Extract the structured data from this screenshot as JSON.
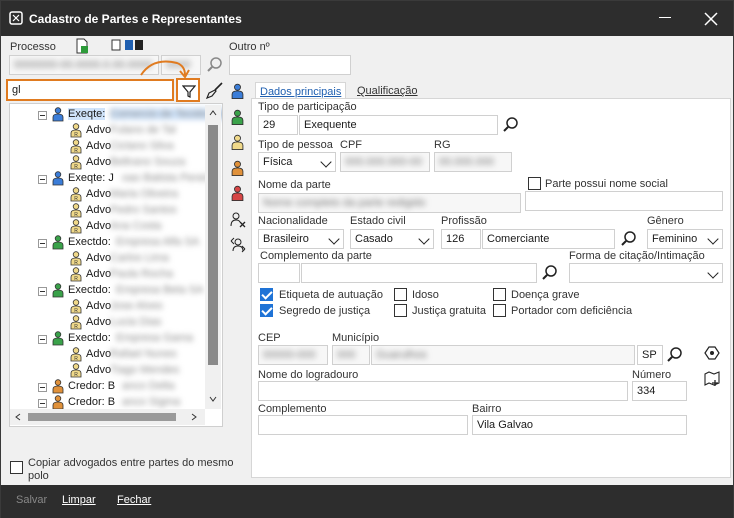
{
  "window": {
    "title": "Cadastro de Partes e Representantes"
  },
  "header": {
    "processo_label": "Processo",
    "outro_label": "Outro nº",
    "processo_value": "0000000-00.0000.0.00.0000",
    "processo_ext": "0000",
    "search_value": "gl"
  },
  "tree": {
    "items": [
      {
        "label": "Exeqte:",
        "blurred": "Comercio de Tecidos Ltda",
        "selected": true,
        "type": "party-blue"
      },
      {
        "label": "Advo",
        "blurred": "Fulano de Tal",
        "type": "lawyer"
      },
      {
        "label": "Advo",
        "blurred": "Ciclano Silva",
        "type": "lawyer"
      },
      {
        "label": "Advo",
        "blurred": "Beltrano Souza",
        "type": "lawyer"
      },
      {
        "label": "Exeqte: J",
        "blurred": "oao Batista Pereira",
        "type": "party-blue"
      },
      {
        "label": "Advo",
        "blurred": "Maria Oliveira",
        "type": "lawyer"
      },
      {
        "label": "Advo",
        "blurred": "Pedro Santos",
        "type": "lawyer"
      },
      {
        "label": "Advo",
        "blurred": "Ana Costa",
        "type": "lawyer"
      },
      {
        "label": "Exectdo:",
        "blurred": "Empresa Alfa SA",
        "type": "party-green"
      },
      {
        "label": "Advo",
        "blurred": "Carlos Lima",
        "type": "lawyer"
      },
      {
        "label": "Advo",
        "blurred": "Paula Rocha",
        "type": "lawyer"
      },
      {
        "label": "Exectdo:",
        "blurred": "Empresa Beta SA",
        "type": "party-green"
      },
      {
        "label": "Advo",
        "blurred": "Jose Alves",
        "type": "lawyer"
      },
      {
        "label": "Advo",
        "blurred": "Lucia Dias",
        "type": "lawyer"
      },
      {
        "label": "Exectdo:",
        "blurred": "Empresa Gama",
        "type": "party-green"
      },
      {
        "label": "Advo",
        "blurred": "Rafael Nunes",
        "type": "lawyer"
      },
      {
        "label": "Advo",
        "blurred": "Tiago Mendes",
        "type": "lawyer"
      },
      {
        "label": "Credor: B",
        "blurred": "anco Delta",
        "type": "party-orange"
      },
      {
        "label": "Credor: B",
        "blurred": "anco Sigma",
        "type": "party-orange"
      }
    ]
  },
  "tabs": [
    {
      "label": "Dados principais",
      "active": true
    },
    {
      "label": "Qualificação",
      "active": false
    }
  ],
  "form": {
    "tipo_participacao_label": "Tipo de participação",
    "tipo_participacao_code": "29",
    "tipo_participacao_value": "Exequente",
    "tipo_pessoa_label": "Tipo de pessoa",
    "tipo_pessoa_value": "Física",
    "cpf_label": "CPF",
    "cpf_value": "000.000.000-00",
    "rg_label": "RG",
    "rg_value": "00.000.000",
    "nome_label": "Nome da parte",
    "nome_value": "Nome completo da parte redigido",
    "nome_social_label": "Parte possui nome social",
    "nacionalidade_label": "Nacionalidade",
    "nacionalidade_value": "Brasileiro",
    "estado_civil_label": "Estado civil",
    "estado_civil_value": "Casado",
    "profissao_label": "Profissão",
    "profissao_code": "126",
    "profissao_value": "Comerciante",
    "genero_label": "Gênero",
    "genero_value": "Feminino",
    "complemento_parte_label": "Complemento da parte",
    "forma_citacao_label": "Forma de citação/Intimação",
    "etiqueta_label": "Etiqueta de autuação",
    "idoso_label": "Idoso",
    "doenca_label": "Doença grave",
    "segredo_label": "Segredo de justiça",
    "justica_label": "Justiça gratuita",
    "portador_label": "Portador com deficiência",
    "cep_label": "CEP",
    "cep_value": "00000-000",
    "municipio_label": "Município",
    "municipio_code": "000",
    "municipio_value": "Guarulhos",
    "uf_value": "SP",
    "logradouro_label": "Nome do logradouro",
    "numero_label": "Número",
    "numero_value": "334",
    "complemento_label": "Complemento",
    "bairro_label": "Bairro",
    "bairro_value": "Vila Galvao"
  },
  "copiar_label": "Copiar advogados entre partes do mesmo polo",
  "footer": {
    "salvar": "Salvar",
    "limpar": "Limpar",
    "fechar": "Fechar"
  },
  "colors": {
    "titlebar": "#2d2d2d",
    "highlight": "#e07b20",
    "check": "#1f73d6"
  }
}
